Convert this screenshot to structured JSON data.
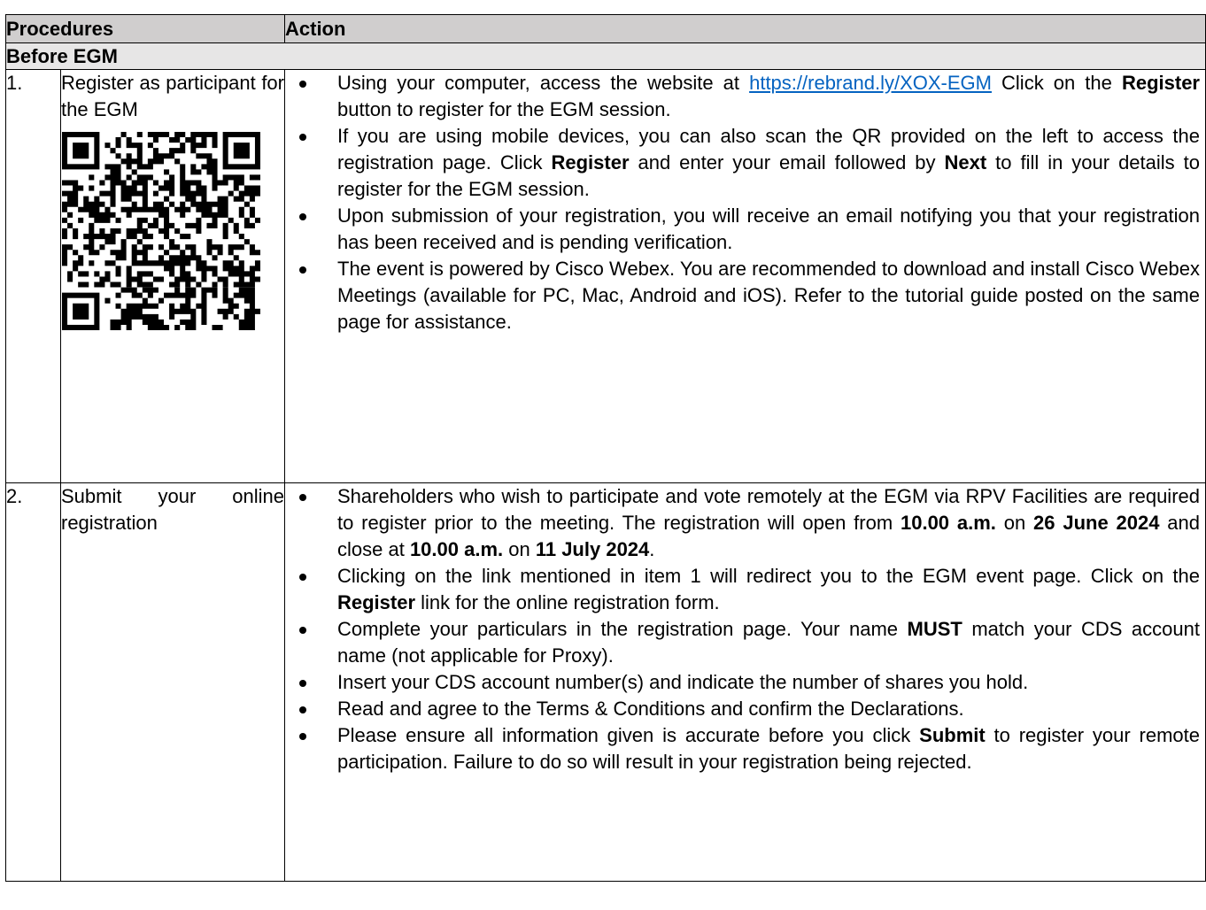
{
  "table": {
    "col_procedures": "Procedures",
    "col_action": "Action"
  },
  "section": {
    "title": "Before EGM"
  },
  "row1": {
    "number": "1.",
    "procedure": "Register as participant for the EGM",
    "bullet1": {
      "pre": "Using your computer, access the website at ",
      "link": "https://rebrand.ly/XOX-EGM",
      "mid": " Click on the ",
      "bold": "Register",
      "post": " button to register for the EGM session."
    },
    "bullet2": {
      "pre": "If you are using mobile devices, you can also scan the QR provided on the left to access the registration page. Click ",
      "bold1": "Register",
      "mid": " and enter your email followed by ",
      "bold2": "Next",
      "post": " to fill in your details to register for the EGM session."
    },
    "bullet3": "Upon submission of your registration, you will receive an email notifying you that your registration has been received and is pending verification.",
    "bullet4": "The event is powered by Cisco Webex. You are recommended to download and install Cisco Webex Meetings (available for PC, Mac, Android and iOS). Refer to the tutorial guide posted on the same page for assistance."
  },
  "row2": {
    "number": "2.",
    "procedure": "Submit your online registration",
    "bullet1": {
      "pre": "Shareholders who wish to participate and vote remotely at the EGM via RPV Facilities are required to register prior to the meeting. The registration will open from ",
      "b1": "10.00 a.m.",
      "t1": " on ",
      "b2": "26 June 2024",
      "t2": " and close at ",
      "b3": "10.00 a.m.",
      "t3": " on ",
      "b4": "11 July 2024",
      "post": "."
    },
    "bullet2": {
      "pre": "Clicking on the link mentioned in item 1 will redirect you to the EGM event page. Click on the ",
      "bold": "Register",
      "post": " link for the online registration form."
    },
    "bullet3": {
      "pre": "Complete your particulars in the registration page. Your name ",
      "bold": "MUST",
      "post": " match your CDS account name (not applicable for Proxy)."
    },
    "bullet4": "Insert your CDS account number(s) and indicate the number of shares you hold.",
    "bullet5": "Read and agree to the Terms & Conditions and confirm the Declarations.",
    "bullet6": {
      "pre": "Please ensure all information given is accurate before you click ",
      "bold": "Submit",
      "post": " to register your remote participation. Failure to do so will result in your registration being rejected."
    }
  },
  "icons": {
    "qr": "qr-code-icon"
  }
}
